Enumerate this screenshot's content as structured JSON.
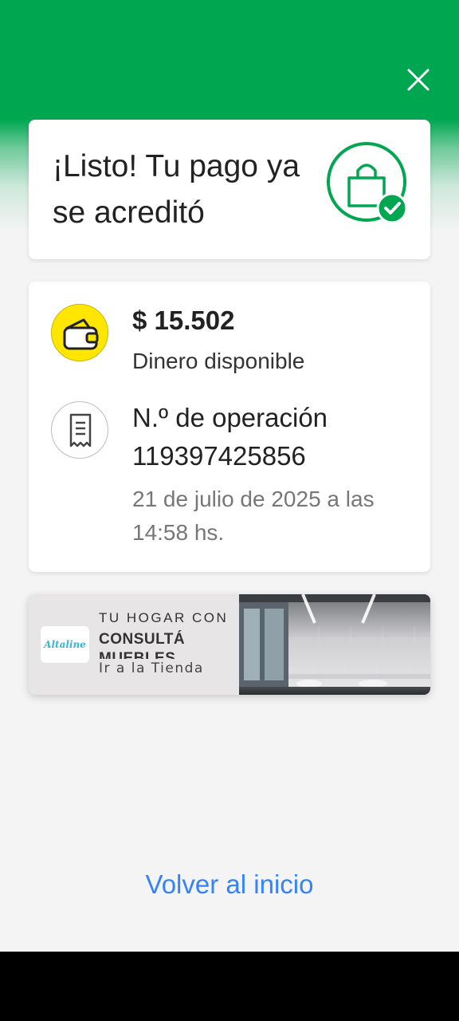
{
  "header": {
    "close_icon": "close-icon"
  },
  "success": {
    "title": "¡Listo! Tu pago ya se acreditó",
    "icon": "shopping-bag-check-icon",
    "accent_color": "#00a650"
  },
  "balance": {
    "amount": "$ 15.502",
    "label": "Dinero disponible",
    "icon": "wallet-icon"
  },
  "operation": {
    "label": "N.º de operación",
    "number": "119397425856",
    "date": "21 de julio de 2025 a las 14:58 hs.",
    "icon": "receipt-icon"
  },
  "ad": {
    "line1": "TU HOGAR CON",
    "line2": "CONSULTÁ MUEBLES",
    "cta": "Ir a la Tienda",
    "logo_text": "Altaline"
  },
  "footer": {
    "home_link": "Volver al inicio"
  }
}
